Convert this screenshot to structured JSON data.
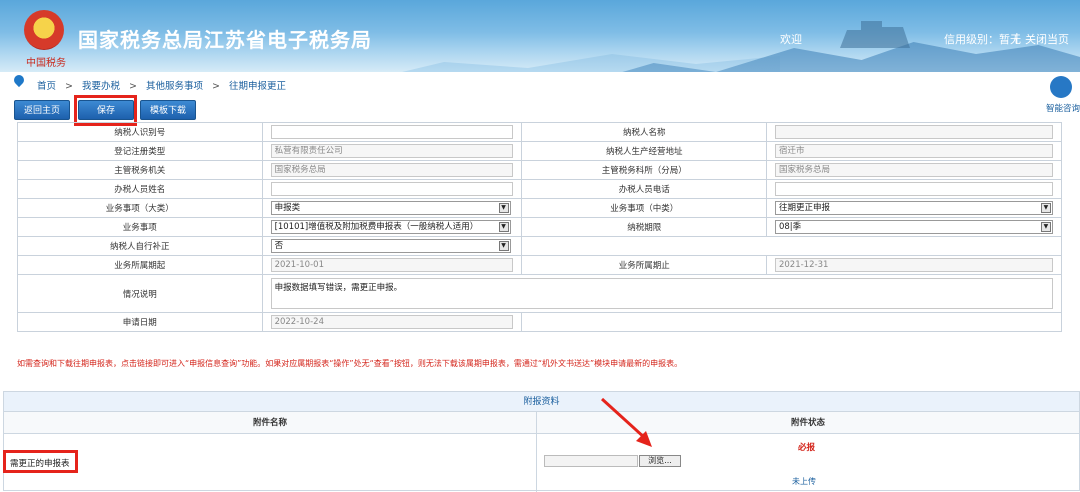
{
  "header": {
    "emblem_text": "中国税务",
    "title": "国家税务总局江苏省电子税务局",
    "welcome": "欢迎",
    "credit_level": "信用级别：暂无",
    "separator": "|",
    "close_page": "关闭当页"
  },
  "breadcrumb": {
    "items": [
      "首页",
      "我要办税",
      "其他服务事项",
      "往期申报更正"
    ],
    "separator": ">"
  },
  "assistant": {
    "label": "智能咨询"
  },
  "toolbar": {
    "home": "返回主页",
    "save": "保存",
    "template": "模板下载"
  },
  "form": {
    "rows": [
      {
        "l1": "纳税人识别号",
        "v1": "",
        "l2": "纳税人名称",
        "v2": ""
      },
      {
        "l1": "登记注册类型",
        "v1": "私营有限责任公司",
        "l2": "纳税人生产经营地址",
        "v2": "宿迁市"
      },
      {
        "l1": "主管税务机关",
        "v1": "国家税务总局",
        "l2": "主管税务科所（分局）",
        "v2": "国家税务总局"
      },
      {
        "l1": "办税人员姓名",
        "v1": "",
        "l2": "办税人员电话",
        "v2": ""
      },
      {
        "l1": "业务事项（大类）",
        "v1": "申报类",
        "l2": "业务事项（中类）",
        "v2": "往期更正申报"
      },
      {
        "l1": "业务事项",
        "v1": "[10101]增值税及附加税费申报表（一般纳税人适用）",
        "l2": "纳税期限",
        "v2": "08|季"
      },
      {
        "l1": "纳税人自行补正",
        "v1": "否"
      },
      {
        "l1": "业务所属期起",
        "v1": "2021-10-01",
        "l2": "业务所属期止",
        "v2": "2021-12-31"
      },
      {
        "l1": "情况说明",
        "v1": "申报数据填写错误，需更正申报。"
      },
      {
        "l1": "申请日期",
        "v1": "2022-10-24"
      }
    ]
  },
  "notice": "如需查询和下载往期申报表，点击链接即可进入“申报信息查询”功能。如果对应属期报表“操作”处无“查看”按钮，则无法下载该属期申报表，需通过“机外文书送达”模块申请最新的申报表。",
  "attachments": {
    "title": "附报资料",
    "col_name": "附件名称",
    "col_status": "附件状态",
    "row_name": "需更正的申报表",
    "required": "必报",
    "browse": "浏览...",
    "status": "未上传"
  }
}
